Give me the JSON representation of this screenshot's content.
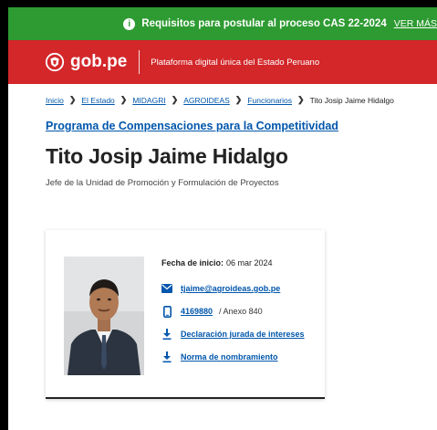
{
  "announcement": {
    "text": "Requisitos para postular al proceso CAS 22-2024",
    "link": "VER MÁS"
  },
  "brand": {
    "logo_text": "gob.pe",
    "tagline": "Plataforma digital única del Estado Peruano"
  },
  "breadcrumb": {
    "items": [
      "Inicio",
      "El Estado",
      "MIDAGRI",
      "AGROIDEAS",
      "Funcionarios"
    ],
    "current": "Tito Josip Jaime Hidalgo"
  },
  "program_link": "Programa de Compensaciones para la Competitividad",
  "person": {
    "name": "Tito Josip Jaime Hidalgo",
    "role": "Jefe de la Unidad de Promoción y Formulación de Proyectos"
  },
  "card": {
    "start_label": "Fecha de inicio:",
    "start_value": "06 mar 2024",
    "email": "tjaime@agroideas.gob.pe",
    "phone": "4169880",
    "extension": "/ Anexo 840",
    "doc1": "Declaración jurada de intereses",
    "doc2": "Norma de nombramiento"
  },
  "colors": {
    "announce_bg": "#2e9b32",
    "brand_bg": "#d3272a",
    "link": "#0056ac"
  },
  "icons": [
    "info-icon",
    "gobpe-emblem-icon",
    "chevron-right-icon",
    "mail-icon",
    "phone-icon",
    "download-icon"
  ]
}
